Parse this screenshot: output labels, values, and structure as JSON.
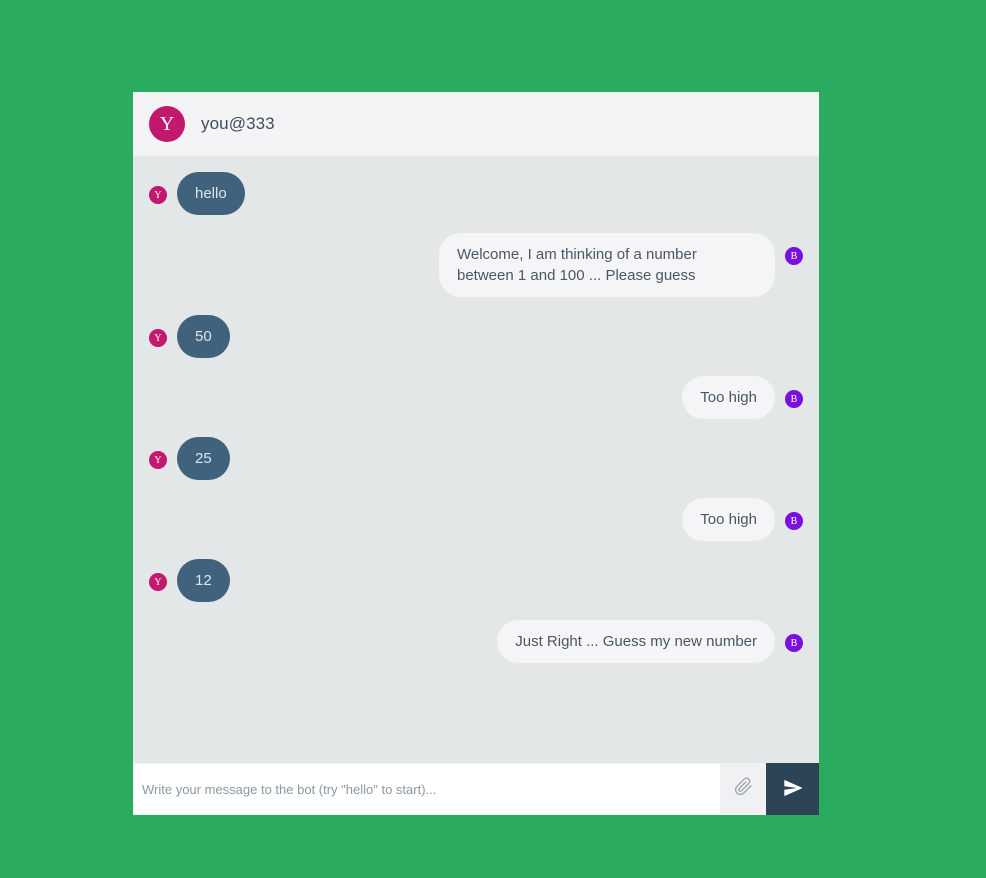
{
  "theme": {
    "page_background": "#2bab5f",
    "header_background": "#f4f4f6",
    "messages_background": "#e3e7e8",
    "user_bubble": "#41627d",
    "bot_bubble": "#f5f5f7",
    "user_avatar": "#c2186e",
    "bot_avatar": "#7a0fe0",
    "send_button": "#2d4356"
  },
  "header": {
    "avatar_letter": "Y",
    "avatar_icon_name": "user-avatar",
    "title": "you@333"
  },
  "conversation": {
    "messages": [
      {
        "sender": "user",
        "avatar_letter": "Y",
        "text": "hello"
      },
      {
        "sender": "bot",
        "avatar_letter": "B",
        "text": "Welcome, I am thinking of a number between 1 and 100 ... Please guess"
      },
      {
        "sender": "user",
        "avatar_letter": "Y",
        "text": "50"
      },
      {
        "sender": "bot",
        "avatar_letter": "B",
        "text": "Too high"
      },
      {
        "sender": "user",
        "avatar_letter": "Y",
        "text": "25"
      },
      {
        "sender": "bot",
        "avatar_letter": "B",
        "text": "Too high"
      },
      {
        "sender": "user",
        "avatar_letter": "Y",
        "text": "12"
      },
      {
        "sender": "bot",
        "avatar_letter": "B",
        "text": "Just Right ... Guess my new number"
      }
    ]
  },
  "composer": {
    "input_value": "",
    "placeholder": "Write your message to the bot (try \"hello\" to start)...",
    "attach_icon_name": "paperclip-icon",
    "send_icon_name": "send-icon"
  }
}
